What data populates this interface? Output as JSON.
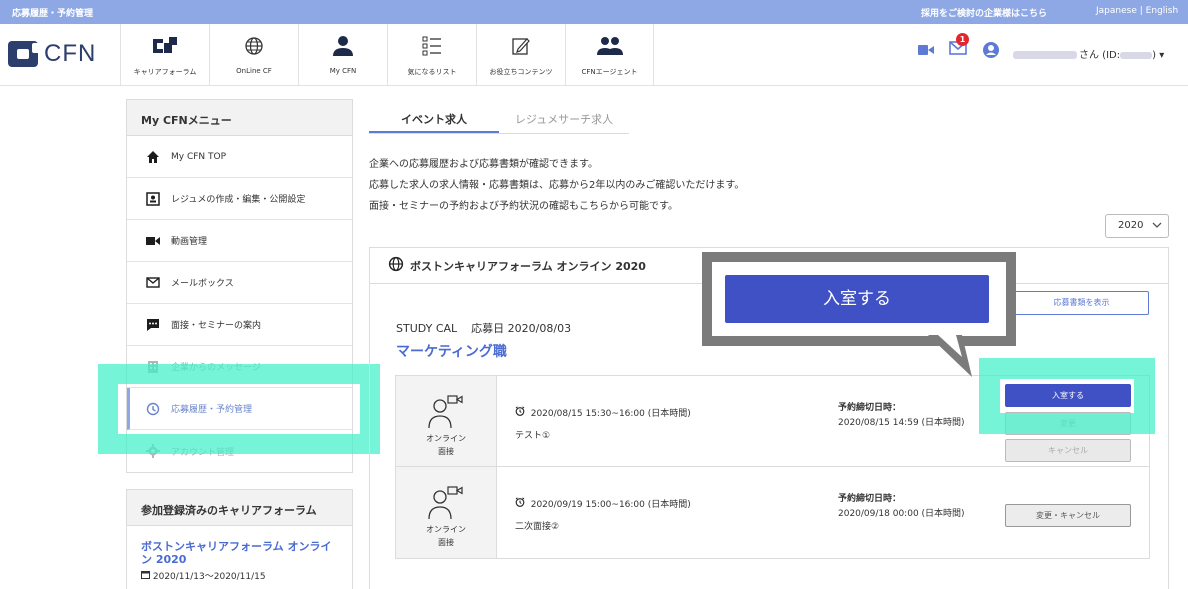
{
  "topstrip": {
    "crumb": "応募履歴・予約管理",
    "recruit": "採用をご検討の企業様はこちら",
    "lang_ja": "Japanese",
    "lang_sep": "|",
    "lang_en": "English"
  },
  "header": {
    "logo_text": "CFN",
    "nav": [
      {
        "label": "キャリアフォーラム",
        "icon": "cf-logo-icon"
      },
      {
        "label": "OnLine CF",
        "icon": "globe-icon"
      },
      {
        "label": "My CFN",
        "icon": "person-icon"
      },
      {
        "label": "気になるリスト",
        "icon": "list-icon"
      },
      {
        "label": "お役立ちコンテンツ",
        "icon": "edit-icon"
      },
      {
        "label": "CFNエージェント",
        "icon": "group-icon"
      }
    ],
    "mail_badge": "1",
    "user_suffix": "さん (ID:",
    "user_suffix_end": ")"
  },
  "sidebar": {
    "menu_title": "My CFNメニュー",
    "items": [
      {
        "label": "My CFN TOP",
        "icon": "home-icon"
      },
      {
        "label": "レジュメの作成・編集・公開設定",
        "icon": "resume-icon"
      },
      {
        "label": "動画管理",
        "icon": "video-icon"
      },
      {
        "label": "メールボックス",
        "icon": "mail-icon"
      },
      {
        "label": "面接・セミナーの案内",
        "icon": "chat-icon"
      },
      {
        "label": "企業からのメッセージ",
        "icon": "building-icon"
      },
      {
        "label": "応募履歴・予約管理",
        "icon": "history-icon"
      },
      {
        "label": "アカウント管理",
        "icon": "gear-icon"
      }
    ],
    "cf_title": "参加登録済みのキャリアフォーラム",
    "cf_link": "ボストンキャリアフォーラム オンライン 2020",
    "cf_date": "2020/11/13〜2020/11/15"
  },
  "main": {
    "tabs": [
      "イベント求人",
      "レジュメサーチ求人"
    ],
    "desc": [
      "企業への応募履歴および応募書類が確認できます。",
      "応募した求人の求人情報・応募書類は、応募から2年以内のみご確認いただけます。",
      "面接・セミナーの予約および予約状況の確認もこちらから可能です。"
    ],
    "year": "2020",
    "panel_title": "ボストンキャリアフォーラム オンライン 2020",
    "doc_button": "応募書類を表示",
    "company": "STUDY CAL",
    "apply_date": "応募日 2020/08/03",
    "job_title": "マーケティング職",
    "rows": [
      {
        "type_line1": "オンライン",
        "type_line2": "面接",
        "time": "2020/08/15 15:30~16:00 (日本時間)",
        "name": "テスト①",
        "deadline_label": "予約締切日時：",
        "deadline": "2020/08/15 14:59 (日本時間)",
        "btn1": "入室する",
        "btn2": "変更",
        "btn3": "キャンセル"
      },
      {
        "type_line1": "オンライン",
        "type_line2": "面接",
        "time": "2020/09/19 15:00~16:00 (日本時間)",
        "name": "二次面接②",
        "deadline_label": "予約締切日時：",
        "deadline": "2020/09/18 00:00 (日本時間)",
        "btn1": "変更・キャンセル"
      }
    ]
  },
  "callout": {
    "button": "入室する"
  },
  "colors": {
    "accent": "#3f51c4",
    "topstrip": "#8ea8e6",
    "highlight": "#40f0c8",
    "link": "#4a6bd1"
  }
}
